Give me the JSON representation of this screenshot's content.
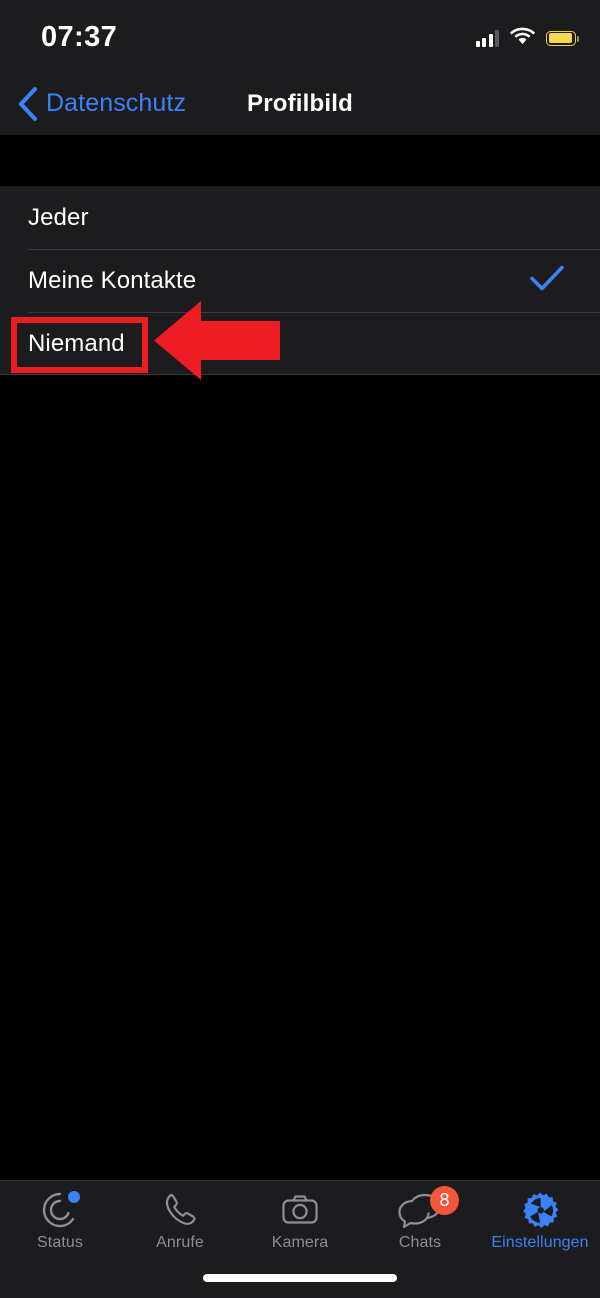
{
  "status_bar": {
    "time": "07:37",
    "cellular_icon": "cellular-signal-icon",
    "wifi_icon": "wifi-icon",
    "battery_icon": "battery-low-power-icon",
    "battery_color": "#f5d84e"
  },
  "nav_bar": {
    "back_icon": "chevron-left-icon",
    "back_label": "Datenschutz",
    "title": "Profilbild",
    "accent_color": "#3b82f6"
  },
  "options": {
    "items": [
      {
        "label": "Jeder",
        "selected": false
      },
      {
        "label": "Meine Kontakte",
        "selected": true
      },
      {
        "label": "Niemand",
        "selected": false
      }
    ],
    "checkmark_icon": "checkmark-icon",
    "checkmark_color": "#3b82f6"
  },
  "annotations": {
    "highlight_target": "Niemand",
    "highlight_color": "#ee1c25",
    "arrow_icon": "arrow-left-icon",
    "arrow_color": "#ee1c25"
  },
  "tab_bar": {
    "items": [
      {
        "label": "Status",
        "icon": "status-rings-icon",
        "active": false,
        "badge": null,
        "dot": true
      },
      {
        "label": "Anrufe",
        "icon": "phone-icon",
        "active": false,
        "badge": null,
        "dot": false
      },
      {
        "label": "Kamera",
        "icon": "camera-icon",
        "active": false,
        "badge": null,
        "dot": false
      },
      {
        "label": "Chats",
        "icon": "chat-bubbles-icon",
        "active": false,
        "badge": "8",
        "dot": false
      },
      {
        "label": "Einstellungen",
        "icon": "gear-icon",
        "active": true,
        "badge": null,
        "dot": false
      }
    ],
    "inactive_color": "#8e8e93",
    "active_color": "#3b82f6",
    "badge_color": "#f4563c",
    "home_indicator": "home-indicator"
  }
}
